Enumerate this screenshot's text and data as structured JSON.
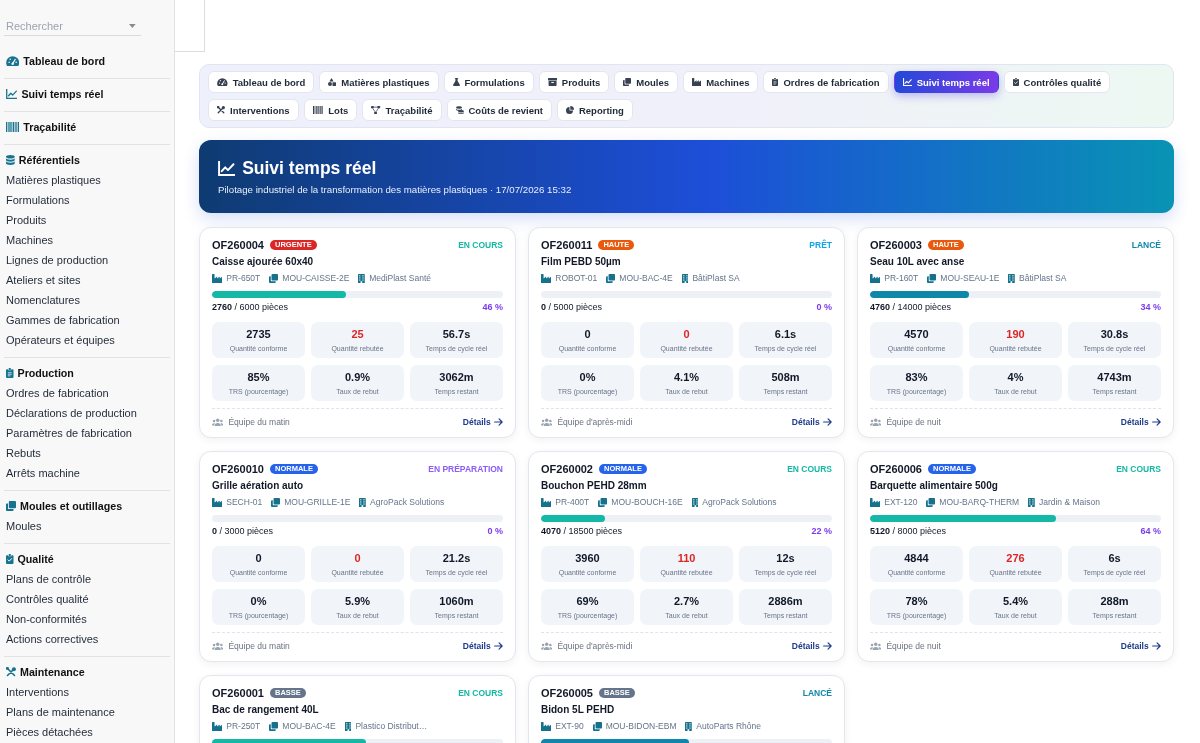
{
  "sidebar": {
    "search": {
      "placeholder": "Rechercher"
    },
    "sections": [
      {
        "title": "Tableau de bord"
      },
      {
        "title": "Suivi temps réel"
      },
      {
        "title": "Traçabilité"
      },
      {
        "title": "Référentiels",
        "items": [
          "Matières plastiques",
          "Formulations",
          "Produits",
          "Machines",
          "Lignes de production",
          "Ateliers et sites",
          "Nomenclatures",
          "Gammes de fabrication",
          "Opérateurs et équipes"
        ]
      },
      {
        "title": "Production",
        "items": [
          "Ordres de fabrication",
          "Déclarations de production",
          "Paramètres de fabrication",
          "Rebuts",
          "Arrêts machine"
        ]
      },
      {
        "title": "Moules et outillages",
        "items": [
          "Moules"
        ]
      },
      {
        "title": "Qualité",
        "items": [
          "Plans de contrôle",
          "Contrôles qualité",
          "Non-conformités",
          "Actions correctives"
        ]
      },
      {
        "title": "Maintenance",
        "items": [
          "Interventions",
          "Plans de maintenance",
          "Pièces détachées"
        ]
      }
    ]
  },
  "tabs": [
    {
      "label": "Tableau de bord",
      "selected": false
    },
    {
      "label": "Matières plastiques",
      "selected": false
    },
    {
      "label": "Formulations",
      "selected": false
    },
    {
      "label": "Produits",
      "selected": false
    },
    {
      "label": "Moules",
      "selected": false
    },
    {
      "label": "Machines",
      "selected": false
    },
    {
      "label": "Ordres de fabrication",
      "selected": false
    },
    {
      "label": "Suivi temps réel",
      "selected": true
    },
    {
      "label": "Contrôles qualité",
      "selected": false
    },
    {
      "label": "Interventions",
      "selected": false
    },
    {
      "label": "Lots",
      "selected": false
    },
    {
      "label": "Traçabilité",
      "selected": false
    },
    {
      "label": "Coûts de revient",
      "selected": false
    },
    {
      "label": "Reporting",
      "selected": false
    }
  ],
  "banner": {
    "title": "Suivi temps réel",
    "subtitle": "Pilotage industriel de la transformation des matières plastiques · 17/07/2026 15:32"
  },
  "orders": [
    {
      "number": "OF260004",
      "priority": {
        "label": "URGENTE",
        "color": "#dc2626"
      },
      "status": {
        "label": "EN COURS",
        "color": "#14b8a6"
      },
      "product": "Caisse ajourée 60x40",
      "machine": "PR-650T",
      "mould": "MOU-CAISSE-2E",
      "client": "MediPlast Santé",
      "progress": {
        "level": 0.46,
        "color": "#14b8a6"
      },
      "quantity": "**2760** / 6000 pièces",
      "percent": "46 %",
      "metrics": [
        {
          "value": "2735",
          "label": "Quantité conforme",
          "alert": false
        },
        {
          "value": "25",
          "label": "Quantité rebutée",
          "alert": true
        },
        {
          "value": "56.7s",
          "label": "Temps de cycle réel",
          "alert": false
        },
        {
          "value": "85%",
          "label": "TRS (pourcentage)",
          "alert": false
        },
        {
          "value": "0.9%",
          "label": "Taux de rebut",
          "alert": false
        },
        {
          "value": "3062m",
          "label": "Temps restant",
          "alert": false
        }
      ],
      "team": "Équipe du matin",
      "details": "Détails"
    },
    {
      "number": "OF260011",
      "priority": {
        "label": "HAUTE",
        "color": "#ea580c"
      },
      "status": {
        "label": "PRÊT",
        "color": "#0ea5e9"
      },
      "product": "Film PEBD 50µm",
      "machine": "ROBOT-01",
      "mould": "MOU-BAC-4E",
      "client": "BâtiPlast SA",
      "quantity": "**0** / 5000 pièces",
      "percent": "0 %",
      "metrics": [
        {
          "value": "0",
          "label": "Quantité conforme",
          "alert": false
        },
        {
          "value": "0",
          "label": "Quantité rebutée",
          "alert": true
        },
        {
          "value": "6.1s",
          "label": "Temps de cycle réel",
          "alert": false
        },
        {
          "value": "0%",
          "label": "TRS (pourcentage)",
          "alert": false
        },
        {
          "value": "4.1%",
          "label": "Taux de rebut",
          "alert": false
        },
        {
          "value": "508m",
          "label": "Temps restant",
          "alert": false
        }
      ],
      "team": "Équipe d'après-midi",
      "details": "Détails"
    },
    {
      "number": "OF260003",
      "priority": {
        "label": "HAUTE",
        "color": "#ea580c"
      },
      "status": {
        "label": "LANCÉ",
        "color": "#0e87a8"
      },
      "product": "Seau 10L avec anse",
      "machine": "PR-160T",
      "mould": "MOU-SEAU-1E",
      "client": "BâtiPlast SA",
      "progress": {
        "level": 0.34,
        "color": "#0e87a8"
      },
      "quantity": "**4760** / 14000 pièces",
      "percent": "34 %",
      "metrics": [
        {
          "value": "4570",
          "label": "Quantité conforme",
          "alert": false
        },
        {
          "value": "190",
          "label": "Quantité rebutée",
          "alert": true
        },
        {
          "value": "30.8s",
          "label": "Temps de cycle réel",
          "alert": false
        },
        {
          "value": "83%",
          "label": "TRS (pourcentage)",
          "alert": false
        },
        {
          "value": "4%",
          "label": "Taux de rebut",
          "alert": false
        },
        {
          "value": "4743m",
          "label": "Temps restant",
          "alert": false
        }
      ],
      "team": "Équipe de nuit",
      "details": "Détails"
    },
    {
      "number": "OF260010",
      "priority": {
        "label": "NORMALE",
        "color": "#2563eb"
      },
      "status": {
        "label": "EN PRÉPARATION",
        "color": "#8b5cf6"
      },
      "product": "Grille aération auto",
      "machine": "SECH-01",
      "mould": "MOU-GRILLE-1E",
      "client": "AgroPack Solutions",
      "quantity": "**0** / 3000 pièces",
      "percent": "0 %",
      "metrics": [
        {
          "value": "0",
          "label": "Quantité conforme",
          "alert": false
        },
        {
          "value": "0",
          "label": "Quantité rebutée",
          "alert": true
        },
        {
          "value": "21.2s",
          "label": "Temps de cycle réel",
          "alert": false
        },
        {
          "value": "0%",
          "label": "TRS (pourcentage)",
          "alert": false
        },
        {
          "value": "5.9%",
          "label": "Taux de rebut",
          "alert": false
        },
        {
          "value": "1060m",
          "label": "Temps restant",
          "alert": false
        }
      ],
      "team": "Équipe du matin",
      "details": "Détails"
    },
    {
      "number": "OF260002",
      "priority": {
        "label": "NORMALE",
        "color": "#2563eb"
      },
      "status": {
        "label": "EN COURS",
        "color": "#14b8a6"
      },
      "product": "Bouchon PEHD 28mm",
      "machine": "PR-400T",
      "mould": "MOU-BOUCH-16E",
      "client": "AgroPack Solutions",
      "progress": {
        "level": 0.22,
        "color": "#14b8a6"
      },
      "quantity": "**4070** / 18500 pièces",
      "percent": "22 %",
      "metrics": [
        {
          "value": "3960",
          "label": "Quantité conforme",
          "alert": false
        },
        {
          "value": "110",
          "label": "Quantité rebutée",
          "alert": true
        },
        {
          "value": "12s",
          "label": "Temps de cycle réel",
          "alert": false
        },
        {
          "value": "69%",
          "label": "TRS (pourcentage)",
          "alert": false
        },
        {
          "value": "2.7%",
          "label": "Taux de rebut",
          "alert": false
        },
        {
          "value": "2886m",
          "label": "Temps restant",
          "alert": false
        }
      ],
      "team": "Équipe d'après-midi",
      "details": "Détails"
    },
    {
      "number": "OF260006",
      "priority": {
        "label": "NORMALE",
        "color": "#2563eb"
      },
      "status": {
        "label": "EN COURS",
        "color": "#14b8a6"
      },
      "product": "Barquette alimentaire 500g",
      "machine": "EXT-120",
      "mould": "MOU-BARQ-THERM",
      "client": "Jardin & Maison",
      "progress": {
        "level": 0.64,
        "color": "#14b8a6"
      },
      "quantity": "**5120** / 8000 pièces",
      "percent": "64 %",
      "metrics": [
        {
          "value": "4844",
          "label": "Quantité conforme",
          "alert": false
        },
        {
          "value": "276",
          "label": "Quantité rebutée",
          "alert": true
        },
        {
          "value": "6s",
          "label": "Temps de cycle réel",
          "alert": false
        },
        {
          "value": "78%",
          "label": "TRS (pourcentage)",
          "alert": false
        },
        {
          "value": "5.4%",
          "label": "Taux de rebut",
          "alert": false
        },
        {
          "value": "288m",
          "label": "Temps restant",
          "alert": false
        }
      ],
      "team": "Équipe de nuit",
      "details": "Détails"
    },
    {
      "number": "OF260001",
      "priority": {
        "label": "BASSE",
        "color": "#64748b"
      },
      "status": {
        "label": "EN COURS",
        "color": "#14b8a6"
      },
      "product": "Bac de rangement 40L",
      "machine": "PR-250T",
      "mould": "MOU-BAC-4E",
      "client": "Plastico Distribut…",
      "progress": {
        "level": 0.53,
        "color": "#14b8a6"
      }
    },
    {
      "number": "OF260005",
      "priority": {
        "label": "BASSE",
        "color": "#64748b"
      },
      "status": {
        "label": "LANCÉ",
        "color": "#0e87a8"
      },
      "product": "Bidon 5L PEHD",
      "machine": "EXT-90",
      "mould": "MOU-BIDON-EBM",
      "client": "AutoParts Rhône",
      "progress": {
        "level": 0.51,
        "color": "#0e87a8"
      }
    }
  ]
}
